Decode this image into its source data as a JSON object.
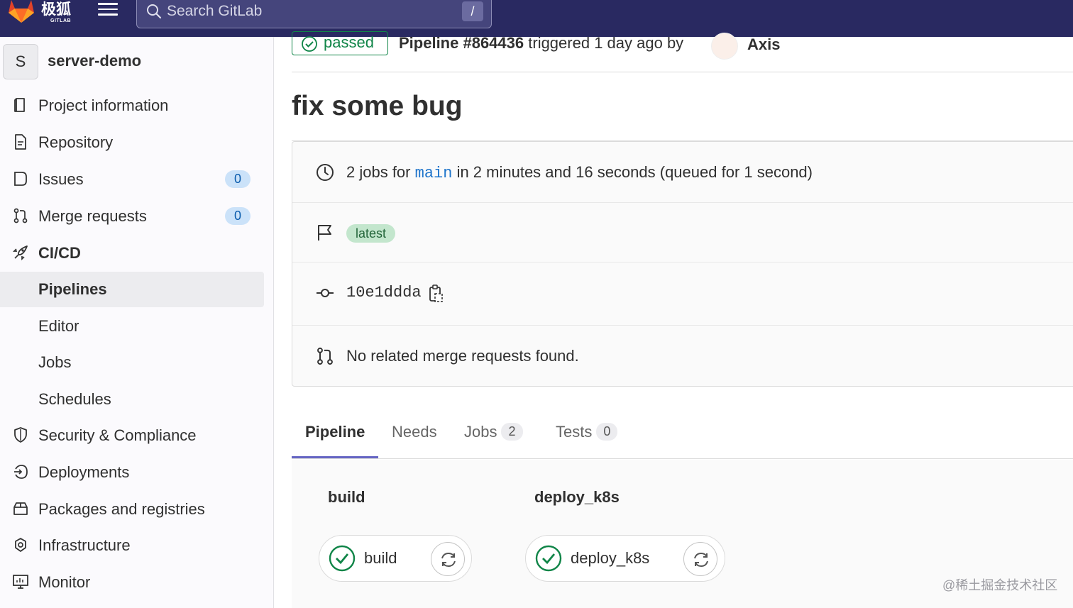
{
  "topbar": {
    "logo_text": "极狐",
    "logo_sub": "GITLAB",
    "search_placeholder": "Search GitLab",
    "search_shortcut": "/"
  },
  "sidebar": {
    "project_initial": "S",
    "project_name": "server-demo",
    "items": [
      {
        "label": "Project information",
        "icon": "book-icon"
      },
      {
        "label": "Repository",
        "icon": "document-icon"
      },
      {
        "label": "Issues",
        "icon": "issues-icon",
        "count": "0"
      },
      {
        "label": "Merge requests",
        "icon": "merge-request-icon",
        "count": "0"
      },
      {
        "label": "CI/CD",
        "icon": "rocket-icon"
      },
      {
        "label": "Pipelines"
      },
      {
        "label": "Editor"
      },
      {
        "label": "Jobs"
      },
      {
        "label": "Schedules"
      },
      {
        "label": "Security & Compliance",
        "icon": "shield-icon"
      },
      {
        "label": "Deployments",
        "icon": "deployments-icon"
      },
      {
        "label": "Packages and registries",
        "icon": "package-icon"
      },
      {
        "label": "Infrastructure",
        "icon": "cloud-gear-icon"
      },
      {
        "label": "Monitor",
        "icon": "monitor-icon"
      }
    ]
  },
  "pipeline": {
    "status": "passed",
    "id_label": "Pipeline #864436",
    "triggered_text": "triggered 1 day ago by",
    "author": "Axis",
    "title": "fix some bug",
    "jobs_prefix": "2 jobs for",
    "branch": "main",
    "jobs_suffix": "in 2 minutes and 16 seconds (queued for 1 second)",
    "tag": "latest",
    "commit_sha": "10e1ddda",
    "merge_requests_text": "No related merge requests found."
  },
  "tabs": [
    {
      "label": "Pipeline"
    },
    {
      "label": "Needs"
    },
    {
      "label": "Jobs",
      "count": "2"
    },
    {
      "label": "Tests",
      "count": "0"
    }
  ],
  "stages": [
    {
      "title": "build",
      "job": "build"
    },
    {
      "title": "deploy_k8s",
      "job": "deploy_k8s"
    }
  ],
  "watermark": "@稀土掘金技术社区",
  "colors": {
    "topbar": "#292961",
    "success": "#108548",
    "link": "#1f75cb",
    "tab_accent": "#6666c4"
  }
}
